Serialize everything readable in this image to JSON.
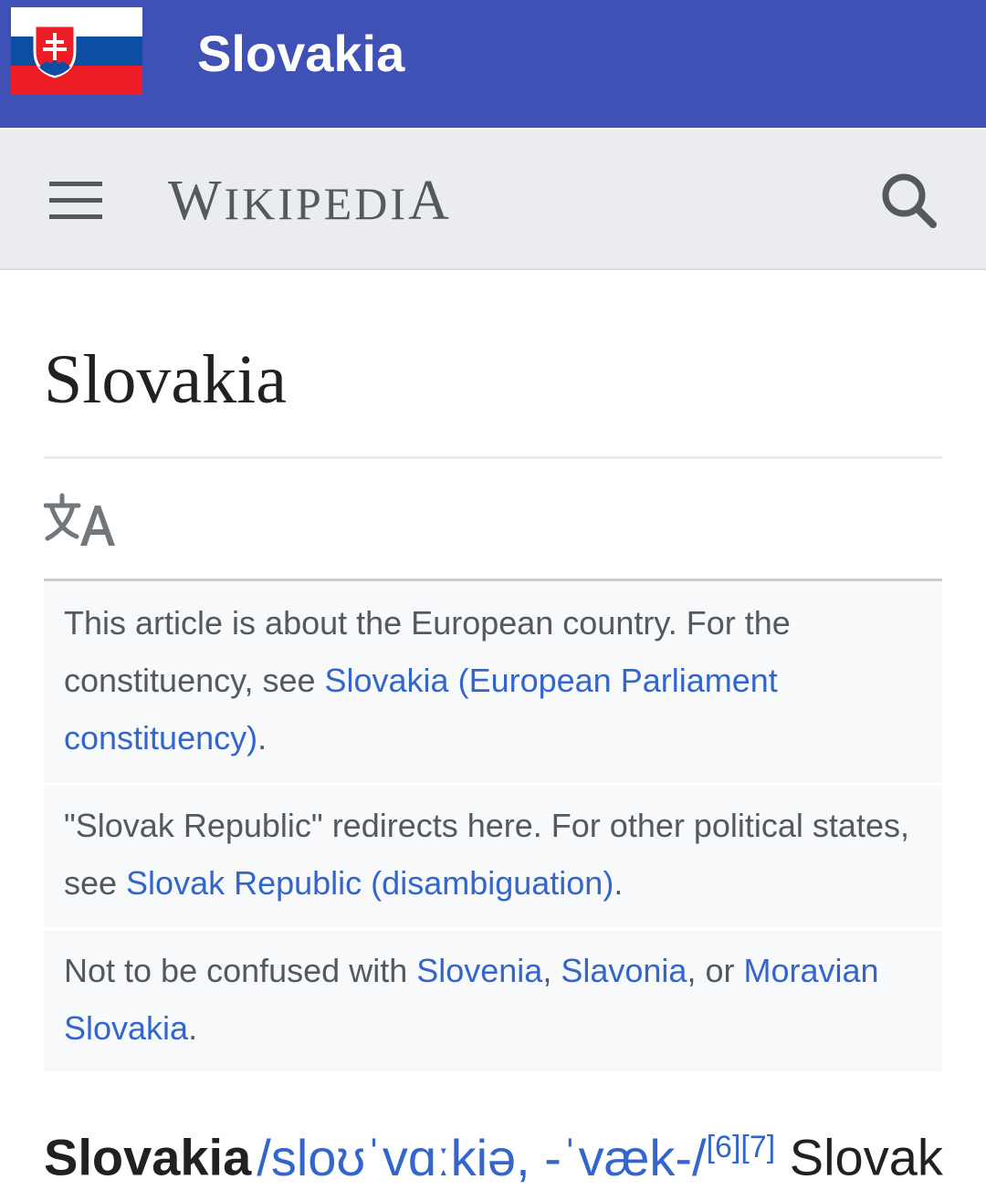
{
  "appbar": {
    "title": "Slovakia",
    "flag_icon": "slovakia-flag-icon"
  },
  "wikibar": {
    "wordmark_w": "W",
    "wordmark_ikipedi": "IKIPEDI",
    "wordmark_a": "A",
    "menu_icon": "hamburger-menu-icon",
    "search_icon": "search-icon"
  },
  "article": {
    "title": "Slovakia",
    "language_icon": "translate-language-icon"
  },
  "hatnotes": [
    {
      "pre": "This article is about the European country. For the constituency, see ",
      "link": "Slovakia (European Parliament constituency)",
      "post": "."
    },
    {
      "pre": "\"Slovak Republic\" redirects here. For other political states, see ",
      "link": "Slovak Republic (disambiguation)",
      "post": "."
    },
    {
      "pre": "Not to be confused with ",
      "link1": "Slovenia",
      "sep1": ", ",
      "link2": "Slavonia",
      "sep2": ", or ",
      "link3": "Moravian Slovakia",
      "post": "."
    }
  ],
  "body_lead": {
    "bold": "Slovakia",
    "ipa": "/sloʊˈvɑːkiə, -ˈvæk-/",
    "refs": "[6][7]",
    "tail": " Slovak"
  },
  "colors": {
    "appbar": "#3f51b5",
    "link": "#3366cc",
    "flag_white": "#ffffff",
    "flag_blue": "#0b4ea2",
    "flag_red": "#ee1c25"
  }
}
